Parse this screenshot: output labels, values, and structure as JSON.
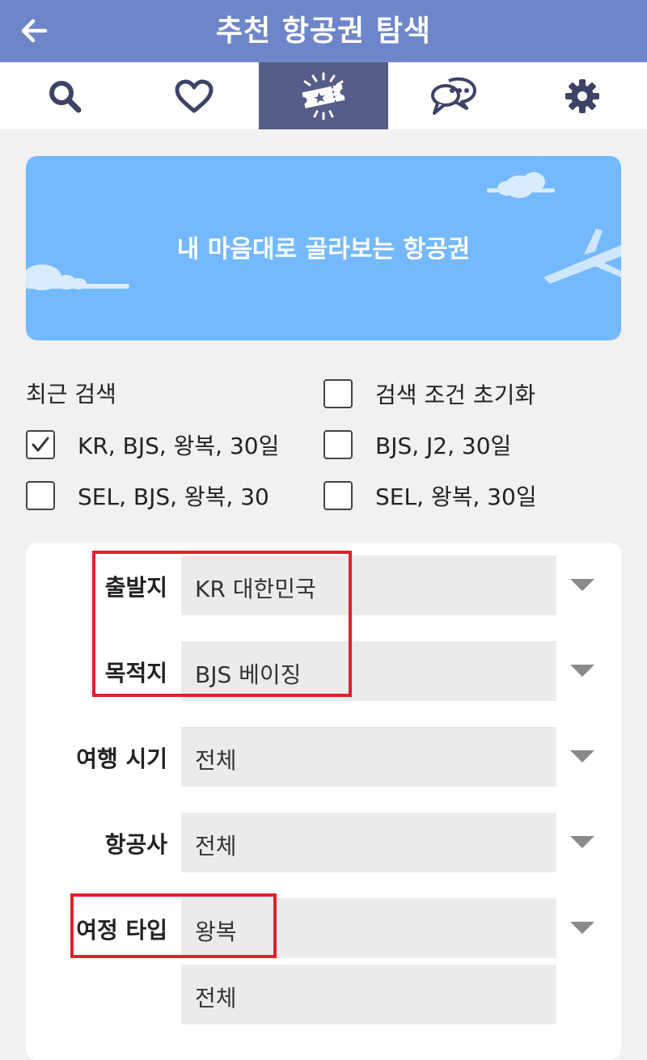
{
  "header": {
    "title": "추천 항공권 탐색",
    "back_icon": "back-arrow-icon"
  },
  "tabs": [
    {
      "icon": "search-icon",
      "active": false
    },
    {
      "icon": "heart-icon",
      "active": false
    },
    {
      "icon": "ticket-icon",
      "active": true
    },
    {
      "icon": "chat-icon",
      "active": false
    },
    {
      "icon": "gear-icon",
      "active": false
    }
  ],
  "banner": {
    "text": "내 마음대로 골라보는 항공권"
  },
  "recent": {
    "title": "최근 검색",
    "reset_label": "검색 조건 초기화",
    "items": [
      {
        "label": "KR, BJS, 왕복, 30일",
        "checked": true
      },
      {
        "label": "BJS, J2, 30일",
        "checked": false
      },
      {
        "label": "SEL, BJS, 왕복, 30",
        "checked": false
      },
      {
        "label": "SEL, 왕복, 30일",
        "checked": false
      }
    ]
  },
  "form": {
    "departure": {
      "label": "출발지",
      "value": "KR 대한민국"
    },
    "destination": {
      "label": "목적지",
      "value": "BJS 베이징"
    },
    "travel_period": {
      "label": "여행 시기",
      "value": "전체"
    },
    "airline": {
      "label": "항공사",
      "value": "전체"
    },
    "trip_type": {
      "label": "여정 타입",
      "value": "왕복"
    },
    "extra": {
      "value": "전체"
    }
  },
  "colors": {
    "header_bg": "#6e86c9",
    "active_tab": "#565d88",
    "banner_bg": "#74b9fd",
    "highlight": "#e0212c"
  }
}
